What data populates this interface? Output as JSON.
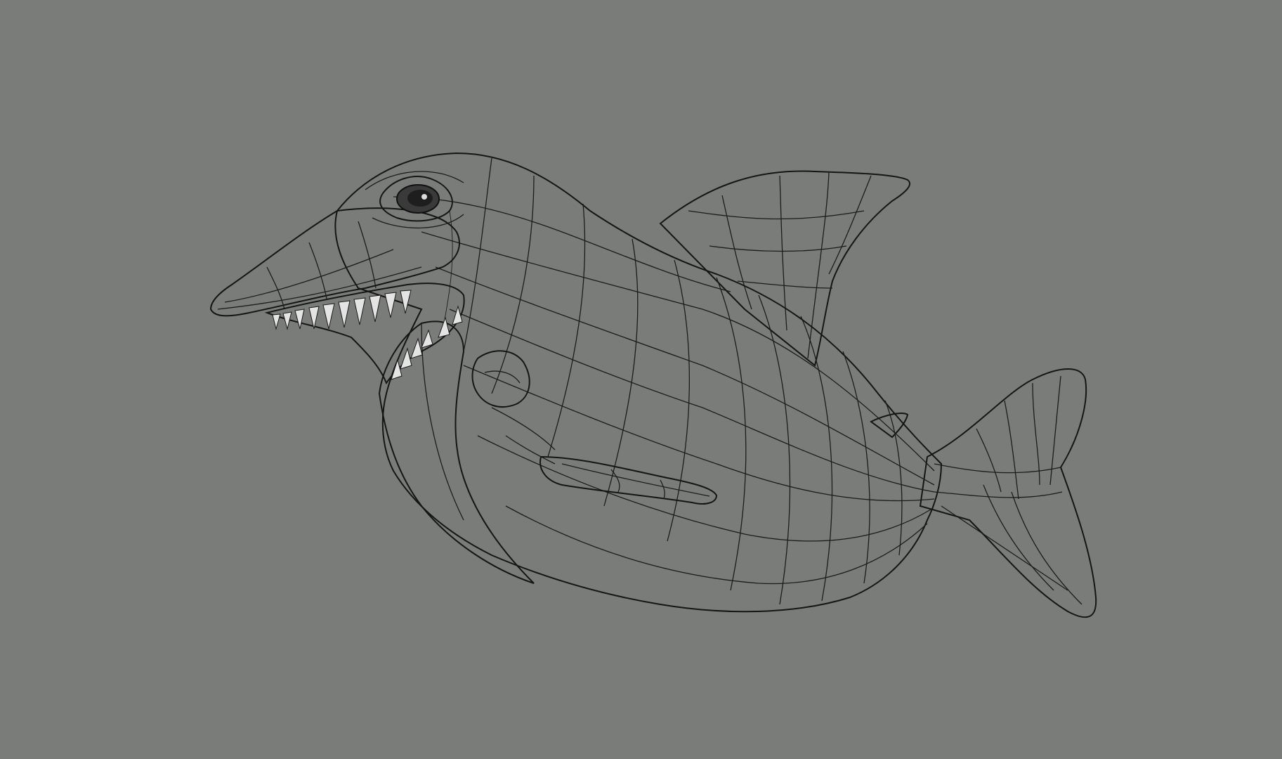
{
  "viewport": {
    "background_color": "#7a7c79",
    "display_mode": "shaded-wireframe"
  },
  "model": {
    "subject": "cartoon-shark",
    "surface_color": "#a9a9a9",
    "highlight_color": "#e6e6e6",
    "shadow_color": "#5b5b5b",
    "wire_color": "#1c1c1c"
  }
}
